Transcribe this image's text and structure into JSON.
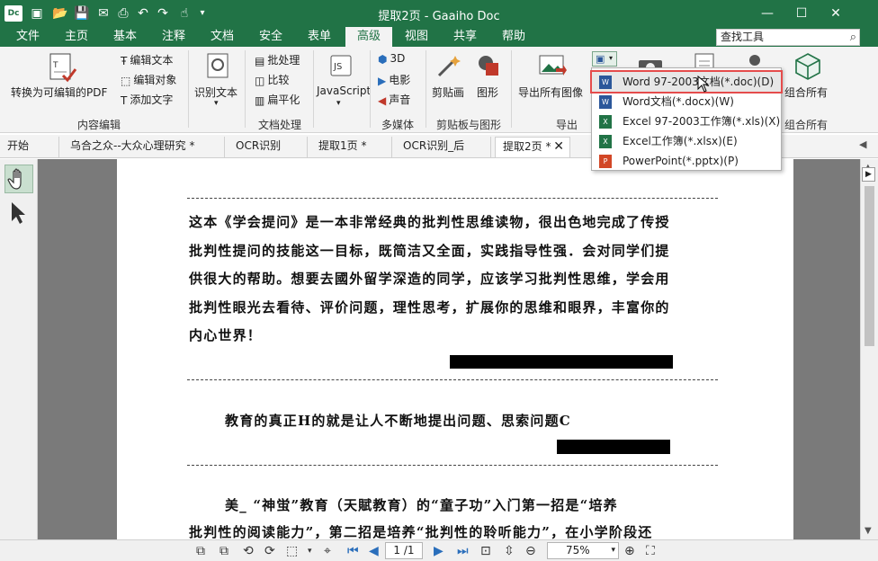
{
  "app": {
    "logo": "Dc",
    "title": "提取2页 - Gaaiho Doc",
    "accent": "#217346",
    "highlight_outline": "#e54c4c"
  },
  "quick_access": {
    "icons": [
      "new-icon",
      "open-icon",
      "save-icon",
      "email-icon",
      "print-icon",
      "undo-icon",
      "redo-icon",
      "hand-icon",
      "customize-icon"
    ]
  },
  "menu": {
    "tabs": [
      "文件",
      "主页",
      "基本",
      "注释",
      "文档",
      "安全",
      "表单",
      "高级",
      "视图",
      "共享",
      "帮助"
    ],
    "active_tab": "高级",
    "search_placeholder": "查找工具"
  },
  "ribbon": {
    "convert_label": "转换为可编辑的PDF",
    "edit_text": "编辑文本",
    "edit_object": "编辑对象",
    "add_text": "添加文字",
    "group_content_edit": "内容编辑",
    "recognize_text": "识别文本",
    "batch": "批处理",
    "compare": "比较",
    "flatten": "扁平化",
    "group_doc_process": "文档处理",
    "javascript": "JavaScript",
    "three_d": "3D",
    "movie": "电影",
    "sound": "声音",
    "group_multimedia": "多媒体",
    "clip_art": "剪贴画",
    "shapes": "图形",
    "group_clipboard_shapes": "剪贴板与图形",
    "export_all_images": "导出所有图像",
    "group_export": "导出",
    "combine_all": "组合所有",
    "group_combine": "组合所有"
  },
  "export_menu": {
    "items": [
      {
        "label": "Word 97-2003文档(*.doc)(D)",
        "icon": "word-icon",
        "color": "#2b579a"
      },
      {
        "label": "Word文档(*.docx)(W)",
        "icon": "word-icon",
        "color": "#2b579a"
      },
      {
        "label": "Excel 97-2003工作簿(*.xls)(X)",
        "icon": "excel-icon",
        "color": "#217346"
      },
      {
        "label": "Excel工作簿(*.xlsx)(E)",
        "icon": "excel-icon",
        "color": "#217346"
      },
      {
        "label": "PowerPoint(*.pptx)(P)",
        "icon": "powerpoint-icon",
        "color": "#d24726"
      }
    ],
    "highlighted_index": 0
  },
  "doc_tabs": {
    "start": "开始",
    "tabs": [
      "乌合之众--大众心理研究 *",
      "OCR识别",
      "提取1页 *",
      "OCR识别_后",
      "提取2页 *"
    ],
    "active": "提取2页 *"
  },
  "document": {
    "para1": "这本《学会提问》是一本非常经典的批判性思维读物，很出色地完成了传授批判性提问的技能这一目标，既简洁又全面，实践指导性强．会对同学们提供很大的帮助。想要去國外留学深造的同学，应该学习批判性思维，学会用批判性眼光去看待、评价问题，理性思考，扩展你的思维和眼界，丰富你的内心世界！",
    "para2": "教育的真正H的就是让人不断地提出问题、思索问题C",
    "para3_line1": "美_ “神蛍”教育（天賦教育）的“童子功”入门第一招是“培养",
    "para3_line2": "批判性的阅读能力”，第二招是培养“批判性的聆听能力”，在小学阶段还"
  },
  "bottom": {
    "page_value": "1 /1",
    "zoom_value": "75%"
  }
}
